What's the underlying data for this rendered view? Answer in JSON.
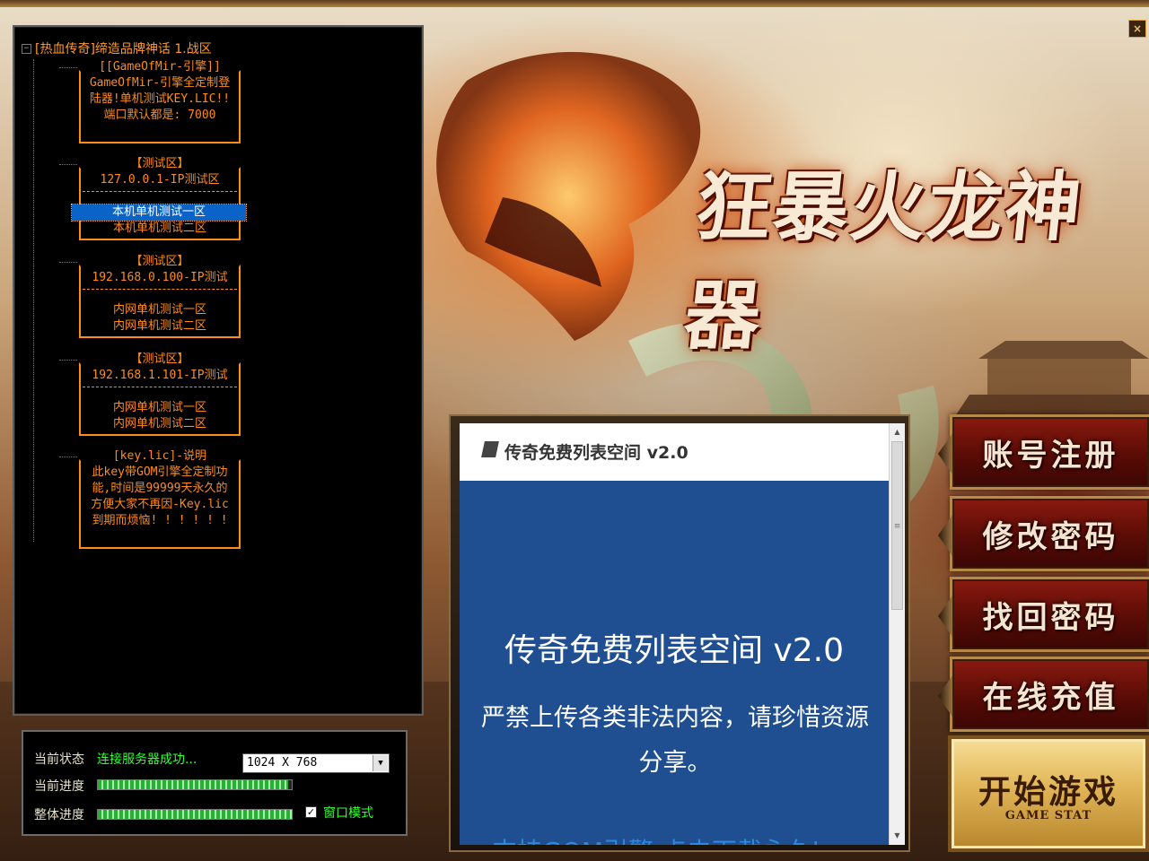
{
  "close_glyph": "×",
  "title_art": "狂暴火龙神器",
  "server_tree": {
    "root_label": "[热血传奇]缔造品牌神话 1.战区",
    "expander": "−",
    "nodes": [
      "[[GameOfMir-引擎]]",
      "GameOfMir-引擎全定制登",
      "陆器!单机测试KEY.LIC!!",
      "端口默认都是: 7000",
      "【测试区】",
      "127.0.0.1-IP测试区",
      "本机单机测试一区",
      "本机单机测试二区",
      "【测试区】",
      "192.168.0.100-IP测试",
      "内网单机测试一区",
      "内网单机测试二区",
      "【测试区】",
      "192.168.1.101-IP测试",
      "内网单机测试一区",
      "内网单机测试二区",
      "[key.lic]-说明",
      "此key带GOM引擎全定制功",
      "能,时间是99999天永久的",
      "方便大家不再因-Key.lic",
      "到期而烦恼! ! ! ! ! !"
    ],
    "selected_index": 6
  },
  "status": {
    "state_label": "当前状态",
    "state_value": "连接服务器成功...",
    "progress_label": "当前进度",
    "progress_value": 0.98,
    "overall_label": "整体进度",
    "overall_value": 1.0,
    "resolution": "1024 X 768",
    "dropdown_arrow": "▼",
    "window_mode_label": "窗口模式",
    "window_mode_checked": "✓"
  },
  "news": {
    "header_title": "传奇免费列表空间 v2.0",
    "title": "传奇免费列表空间 v2.0",
    "notice": "严禁上传各类非法内容，请珍惜资源分享。",
    "link": "支持GOM引擎,点击下载永久key",
    "scroll_up": "▲",
    "scroll_down": "▼",
    "scroll_grip": "≡"
  },
  "actions": {
    "register": "账号注册",
    "change_password": "修改密码",
    "recover_password": "找回密码",
    "recharge": "在线充值"
  },
  "start": {
    "label": "开始游戏",
    "sub_label": "GAME STAT"
  },
  "colors": {
    "tree_text": "#ff8c1a",
    "status_text": "#33ff33",
    "news_blue": "#1f4f91",
    "link_blue": "#2a8ae0",
    "selection": "#0a64c8"
  }
}
